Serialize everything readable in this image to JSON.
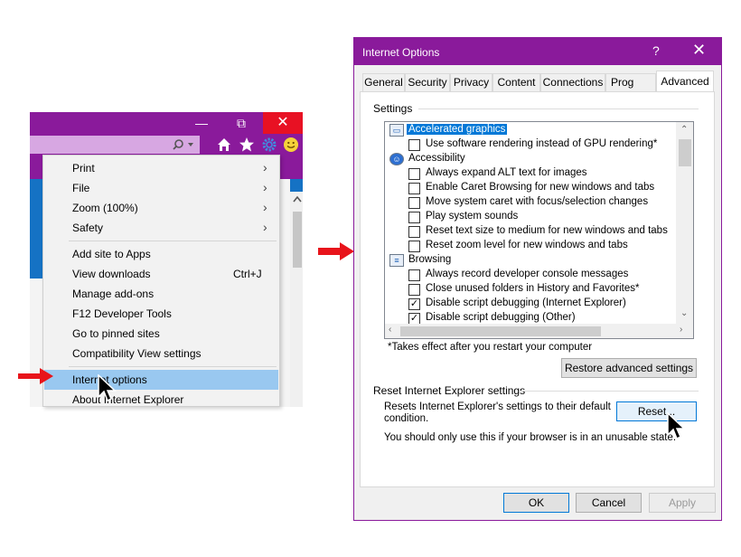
{
  "colors": {
    "accent": "#8a1a9b",
    "highlight": "#99c8f0",
    "selection": "#0078d7",
    "arrow": "#e8141b",
    "close": "#e81123"
  },
  "ie_window": {
    "caption": {
      "minimize_glyph": "—",
      "restore_glyph": "⧉",
      "close_glyph": "✕"
    },
    "toolbar_icons": [
      "search-icon",
      "home-icon",
      "favorites-star-icon",
      "gear-icon",
      "smiley-feedback-icon"
    ]
  },
  "tools_menu": {
    "items": [
      {
        "label": "Print",
        "submenu": true
      },
      {
        "label": "File",
        "submenu": true
      },
      {
        "label": "Zoom (100%)",
        "submenu": true
      },
      {
        "label": "Safety",
        "submenu": true
      },
      {
        "label": "Add site to Apps"
      },
      {
        "label": "View downloads",
        "shortcut": "Ctrl+J"
      },
      {
        "label": "Manage add-ons"
      },
      {
        "label": "F12 Developer Tools"
      },
      {
        "label": "Go to pinned sites"
      },
      {
        "label": "Compatibility View settings"
      },
      {
        "label": "Internet options",
        "highlighted": true
      },
      {
        "label": "About Internet Explorer"
      }
    ]
  },
  "dialog": {
    "title": "Internet Options",
    "help_glyph": "?",
    "close_glyph": "✕",
    "tabs": [
      "General",
      "Security",
      "Privacy",
      "Content",
      "Connections",
      "Prog",
      "Advanced"
    ],
    "active_tab": "Advanced",
    "settings_label": "Settings",
    "settings": [
      {
        "type": "group",
        "label": "Accelerated graphics",
        "icon": "display-icon",
        "selected": true
      },
      {
        "type": "check",
        "label": "Use software rendering instead of GPU rendering*",
        "checked": false
      },
      {
        "type": "group",
        "label": "Accessibility",
        "icon": "accessibility-icon"
      },
      {
        "type": "check",
        "label": "Always expand ALT text for images",
        "checked": false
      },
      {
        "type": "check",
        "label": "Enable Caret Browsing for new windows and tabs",
        "checked": false
      },
      {
        "type": "check",
        "label": "Move system caret with focus/selection changes",
        "checked": false
      },
      {
        "type": "check",
        "label": "Play system sounds",
        "checked": false
      },
      {
        "type": "check",
        "label": "Reset text size to medium for new windows and tabs",
        "checked": false
      },
      {
        "type": "check",
        "label": "Reset zoom level for new windows and tabs",
        "checked": false
      },
      {
        "type": "group",
        "label": "Browsing",
        "icon": "browsing-icon"
      },
      {
        "type": "check",
        "label": "Always record developer console messages",
        "checked": false
      },
      {
        "type": "check",
        "label": "Close unused folders in History and Favorites*",
        "checked": false
      },
      {
        "type": "check",
        "label": "Disable script debugging (Internet Explorer)",
        "checked": true
      },
      {
        "type": "check",
        "label": "Disable script debugging (Other)",
        "checked": true
      }
    ],
    "footnote": "*Takes effect after you restart your computer",
    "restore_button": "Restore advanced settings",
    "reset_group_label": "Reset Internet Explorer settings",
    "reset_description": "Resets Internet Explorer's settings to their default condition.",
    "reset_button": "Reset...",
    "reset_warning": "You should only use this if your browser is in an unusable state.",
    "ok_button": "OK",
    "cancel_button": "Cancel",
    "apply_button": "Apply"
  }
}
